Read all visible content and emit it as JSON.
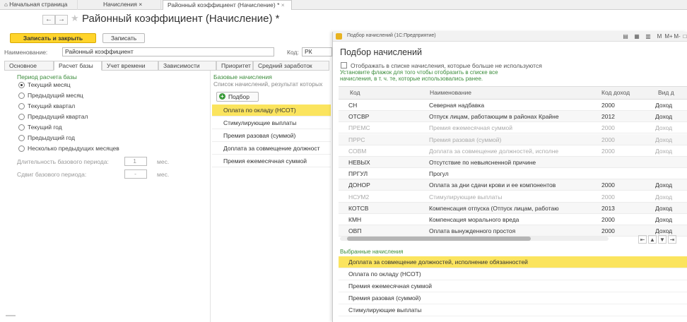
{
  "tabs": {
    "home": "Начальная страница",
    "charges": "Начисления",
    "current": "Районный коэффициент (Начисление) *"
  },
  "header": {
    "back": "←",
    "forward": "→",
    "star": "★",
    "title": "Районный коэффициент (Начисление) *"
  },
  "toolbar": {
    "save_close": "Записать и закрыть",
    "save": "Записать"
  },
  "form": {
    "name_label": "Наименование:",
    "name_value": "Районный коэффициент",
    "code_label": "Код:",
    "code_value": "РК"
  },
  "subtabs": [
    "Основное",
    "Расчет базы",
    "Учет времени",
    "Зависимости",
    "Приоритет",
    "Средний заработок"
  ],
  "period": {
    "title": "Период расчета базы",
    "options": [
      "Текущий месяц",
      "Предыдущий месяц",
      "Текущий квартал",
      "Предыдущий квартал",
      "Текущий год",
      "Предыдущий год",
      "Несколько предыдущих месяцев"
    ],
    "selected": 0,
    "duration_label": "Длительность базового периода:",
    "duration_value": "1",
    "shift_label": "Сдвиг базового периода:",
    "shift_value": "-",
    "unit": "мес."
  },
  "base": {
    "title": "Базовые начисления",
    "hint": "Список начислений, результат которых",
    "add_btn": "Подбор",
    "items": [
      "Оплата по окладу (НСОТ)",
      "Стимулирующие выплаты",
      "Премия разовая (суммой)",
      "Доплата за совмещение должност",
      "Премия ежемесячная суммой"
    ]
  },
  "dialog": {
    "window_title": "Подбор начислений  (1С:Предприятие)",
    "window_controls": [
      "M",
      "M+",
      "M-"
    ],
    "heading": "Подбор начислений",
    "checkbox_label": "Отображать в списке начисления, которые больше не используются",
    "hint1": "Установите флажок для того чтобы отобразить в списке все",
    "hint2": "начисления, в т. ч. те, которые использовались ранее.",
    "columns": [
      "Код",
      "Наименование",
      "Код доход",
      "Вид д"
    ],
    "rows": [
      {
        "code": "СН",
        "name": "Северная надбавка",
        "inc": "2000",
        "kind": "Доход",
        "gray": false
      },
      {
        "code": "ОТСВР",
        "name": "Отпуск лицам, работающим в районах Крайне",
        "inc": "2012",
        "kind": "Доход",
        "gray": false
      },
      {
        "code": "ПРЕМС",
        "name": "Премия ежемесячная суммой",
        "inc": "2000",
        "kind": "Доход",
        "gray": true
      },
      {
        "code": "ПРРС",
        "name": "Премия разовая (суммой)",
        "inc": "2000",
        "kind": "Доход",
        "gray": true
      },
      {
        "code": "СОВМ",
        "name": "Доплата за совмещение должностей, исполне",
        "inc": "2000",
        "kind": "Доход",
        "gray": true
      },
      {
        "code": "НЕВЫХ",
        "name": "Отсутствие по невыясненной причине",
        "inc": "",
        "kind": "",
        "gray": false
      },
      {
        "code": "ПРГУЛ",
        "name": "Прогул",
        "inc": "",
        "kind": "",
        "gray": false
      },
      {
        "code": "ДОНОР",
        "name": "Оплата за дни сдачи крови и ее компонентов",
        "inc": "2000",
        "kind": "Доход",
        "gray": false
      },
      {
        "code": "НСУМ2",
        "name": "Стимулирующие выплаты",
        "inc": "2000",
        "kind": "Доход",
        "gray": true
      },
      {
        "code": "КОТСВ",
        "name": "Компенсация отпуска (Отпуск лицам, работаю",
        "inc": "2013",
        "kind": "Доход",
        "gray": false
      },
      {
        "code": "КМН",
        "name": "Компенсация морального вреда",
        "inc": "2000",
        "kind": "Доход",
        "gray": false
      },
      {
        "code": "ОВП",
        "name": "Оплата вынужденного простоя",
        "inc": "2000",
        "kind": "Доход",
        "gray": false
      }
    ],
    "selected_title": "Выбранные начисления",
    "selected_items": [
      "Доплата за совмещение должностей, исполнение обязанностей",
      "Оплата по окладу (НСОТ)",
      "Премия ежемесячная суммой",
      "Премия разовая (суммой)",
      "Стимулирующие выплаты"
    ]
  },
  "colors": {
    "accent": "#ffd42b",
    "selection": "#fbe45e",
    "green": "#3b8c3b"
  }
}
